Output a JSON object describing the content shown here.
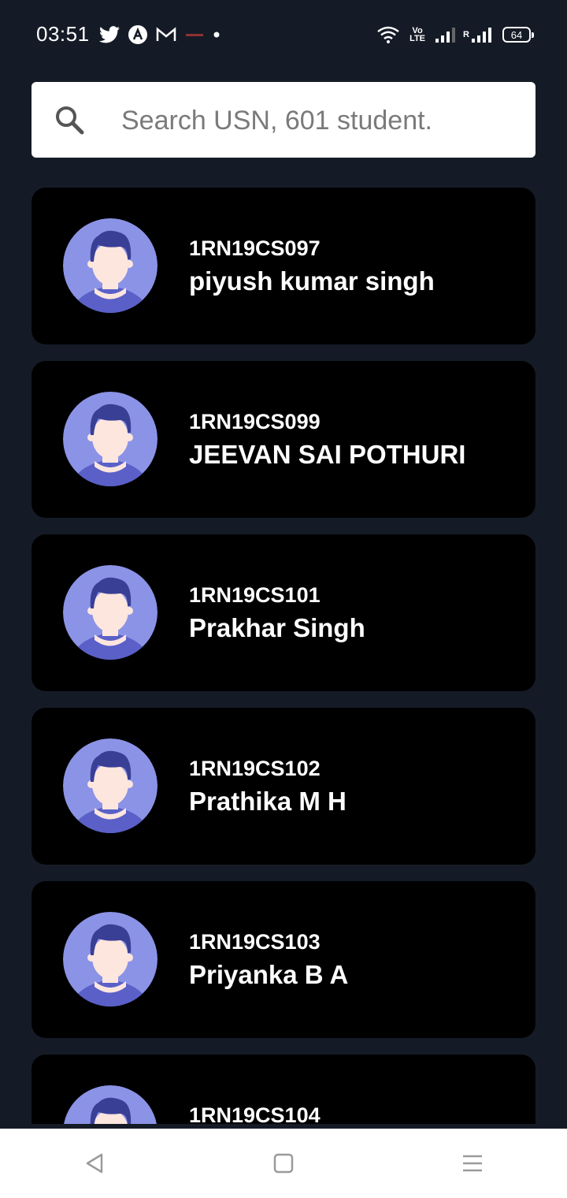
{
  "status_bar": {
    "time": "03:51",
    "left_icons": [
      "twitter-icon",
      "a-circle-icon",
      "gmail-icon",
      "notification-dot-icon"
    ],
    "right_icons": [
      "wifi-icon",
      "volte-icon",
      "signal-1-icon",
      "signal-2-icon",
      "battery-icon"
    ],
    "volte_label": "Vo LTE",
    "signal_r_label": "R",
    "battery_level": "64"
  },
  "search": {
    "placeholder": "Search USN, 601 student.",
    "value": ""
  },
  "students": [
    {
      "usn": "1RN19CS097",
      "name": "piyush kumar singh"
    },
    {
      "usn": "1RN19CS099",
      "name": "JEEVAN SAI POTHURI"
    },
    {
      "usn": "1RN19CS101",
      "name": "Prakhar Singh"
    },
    {
      "usn": "1RN19CS102",
      "name": "Prathika M H"
    },
    {
      "usn": "1RN19CS103",
      "name": "Priyanka B A"
    },
    {
      "usn": "1RN19CS104",
      "name": ""
    }
  ],
  "nav": {
    "items": [
      "back-icon",
      "home-icon",
      "menu-icon"
    ]
  },
  "colors": {
    "background": "#151b26",
    "card": "#000000",
    "avatar_bg": "#8b93e6",
    "hair": "#3a3f96"
  }
}
